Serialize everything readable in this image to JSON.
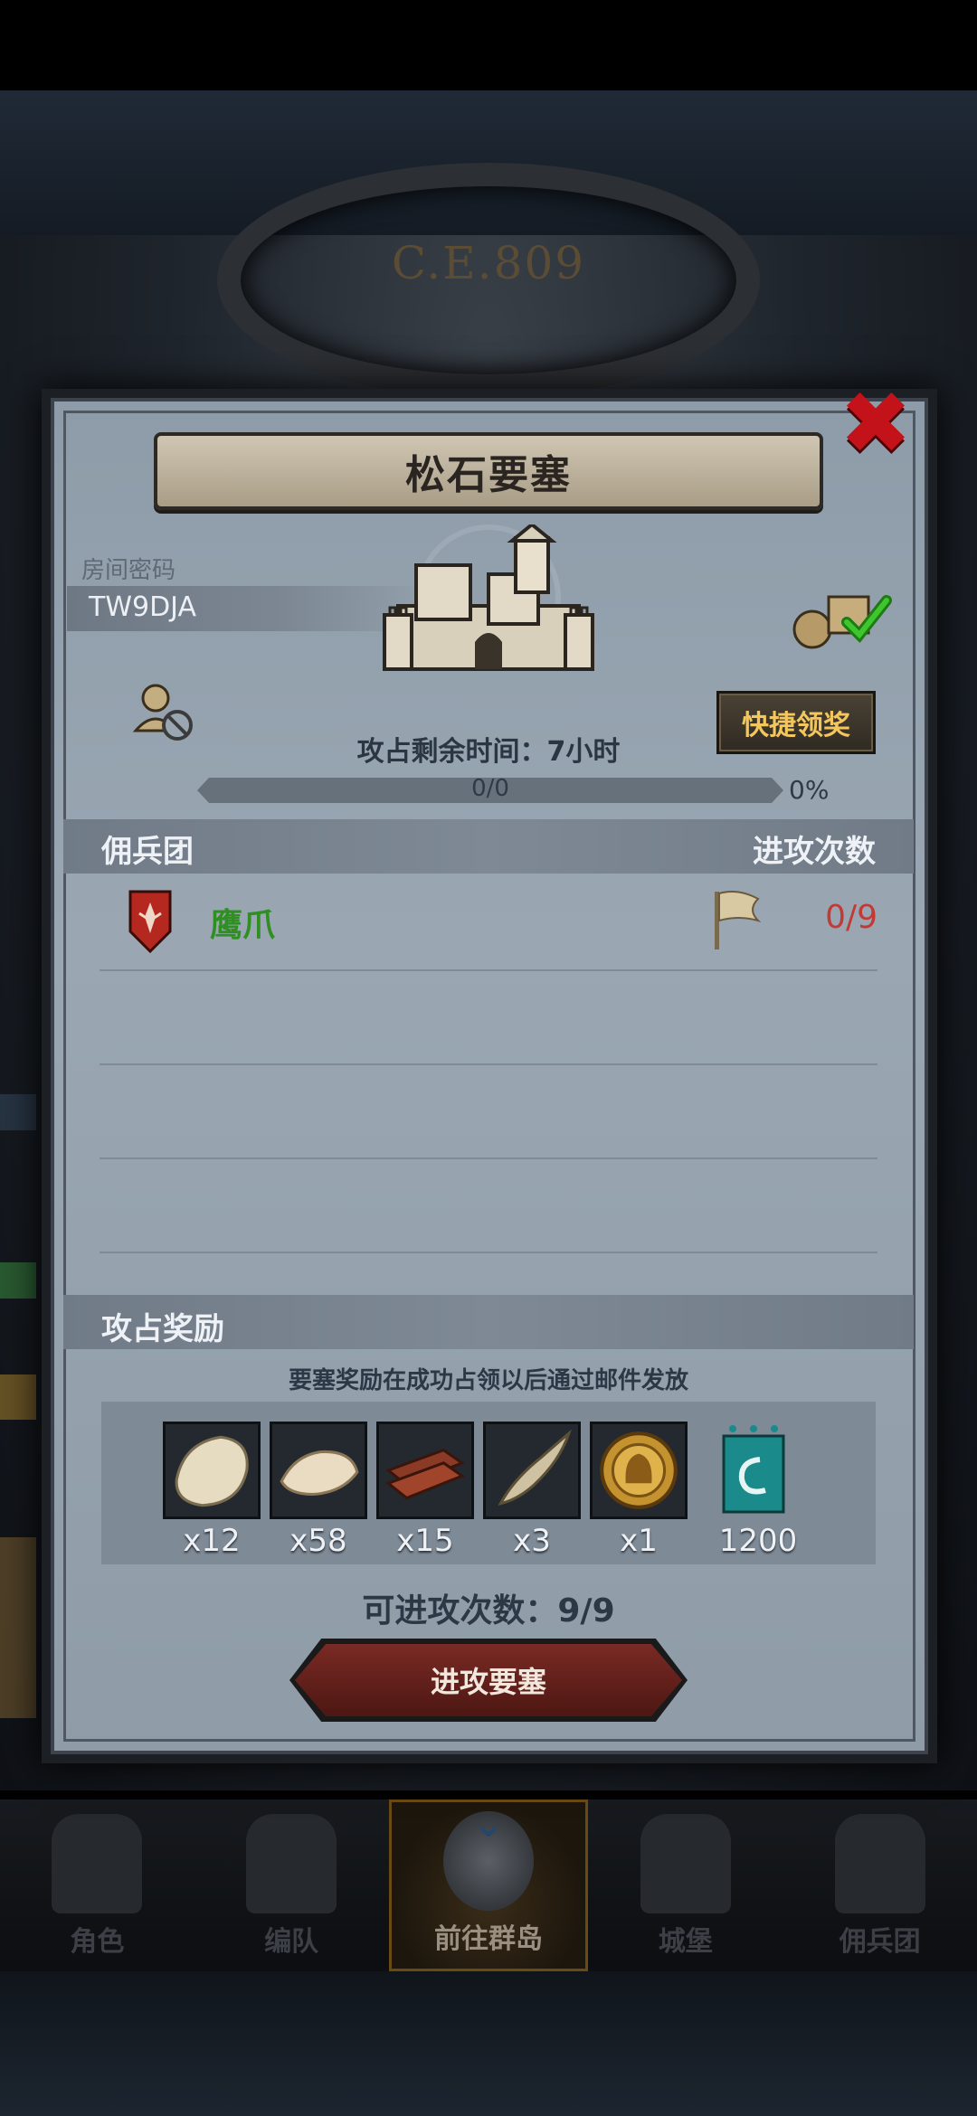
{
  "background": {
    "year_text": "C.E.809"
  },
  "dialog": {
    "title": "松石要塞",
    "room_label": "房间密码",
    "room_code": "TW9DJA",
    "quick_claim_label": "快捷领奖",
    "remaining_time_text": "攻占剩余时间：7小时",
    "progress": {
      "text": "0/0",
      "percent_text": "0%",
      "fill_fraction": 0
    },
    "mercenary_header": "佣兵团",
    "attack_count_header": "进攻次数",
    "mercenaries": [
      {
        "name": "鹰爪",
        "attacks": "0/9"
      }
    ],
    "reward_header": "攻占奖励",
    "reward_note": "要塞奖励在成功占领以后通过邮件发放",
    "rewards": [
      {
        "icon": "fur-pelt-icon",
        "qty": "x12"
      },
      {
        "icon": "cotton-fiber-icon",
        "qty": "x58"
      },
      {
        "icon": "wood-planks-icon",
        "qty": "x15"
      },
      {
        "icon": "horn-icon",
        "qty": "x3"
      },
      {
        "icon": "knight-medal-icon",
        "qty": "x1"
      },
      {
        "icon": "guild-banner-icon",
        "qty": "1200"
      }
    ],
    "available_attacks_text": "可进攻次数：9/9",
    "attack_button_label": "进攻要塞"
  },
  "bottom_nav": {
    "items": [
      {
        "label": "角色",
        "icon": "knight-icon"
      },
      {
        "label": "编队",
        "icon": "helmet-icon"
      },
      {
        "label": "前往群岛",
        "icon": "globe-icon",
        "active": true
      },
      {
        "label": "城堡",
        "icon": "castle-icon"
      },
      {
        "label": "佣兵团",
        "icon": "mercenary-icon"
      }
    ]
  },
  "colors": {
    "close_red": "#c4121a",
    "merc_name_green": "#2f8f22",
    "count_red": "#c23a36",
    "quick_claim_gold": "#f3c75e",
    "attack_button": "#6a241f"
  }
}
